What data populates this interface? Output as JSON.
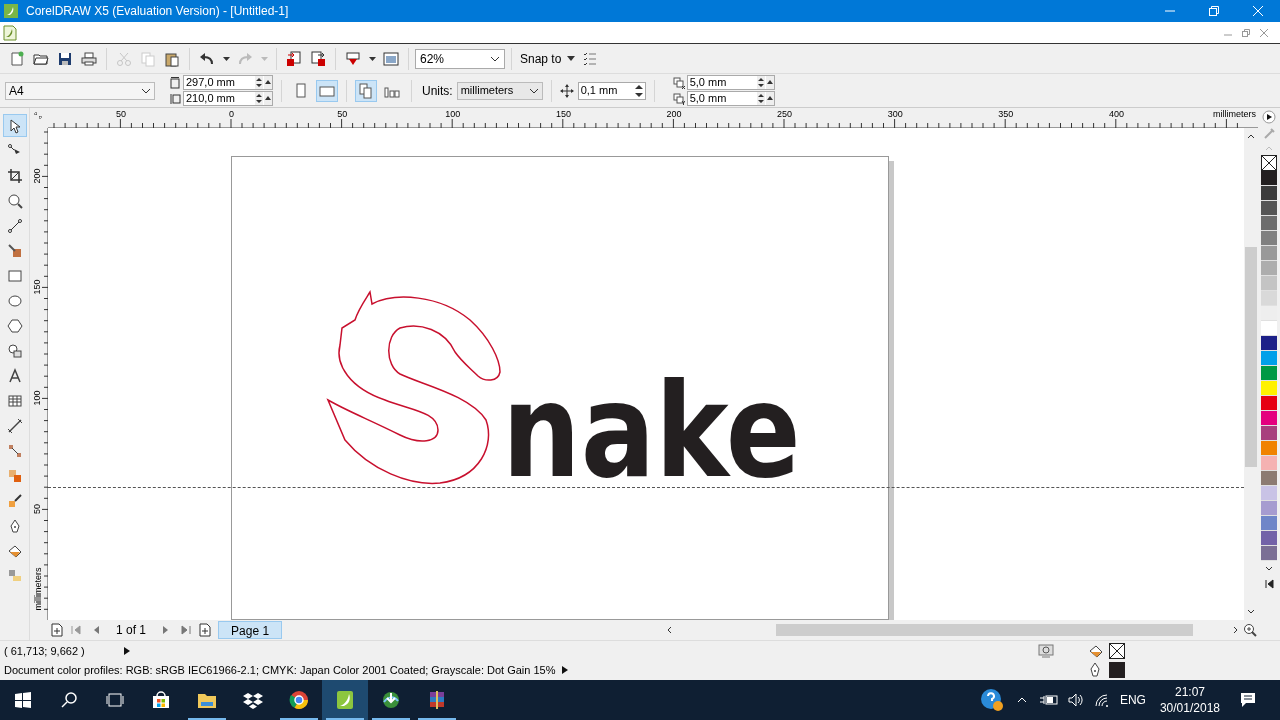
{
  "window": {
    "title": "CorelDRAW X5 (Evaluation Version) - [Untitled-1]"
  },
  "standard_toolbar": {
    "zoom_level": "62%",
    "snap_to": "Snap to"
  },
  "property_bar": {
    "page_size": "A4",
    "width": "297,0 mm",
    "height": "210,0 mm",
    "orientation": [
      {
        "kind": "portrait",
        "selected": false
      },
      {
        "kind": "landscape",
        "selected": true
      }
    ],
    "page_layout": [
      {
        "kind": "all-pages",
        "selected": true
      },
      {
        "kind": "current-page",
        "selected": false
      }
    ],
    "units_label": "Units:",
    "units": "millimeters",
    "nudge": "0,1 mm",
    "duplicate_x": "5,0 mm",
    "duplicate_y": "5,0 mm"
  },
  "toolbox": [
    {
      "kind": "pick",
      "selected": true
    },
    {
      "kind": "shape",
      "selected": false
    },
    {
      "kind": "crop",
      "selected": false
    },
    {
      "kind": "zoom",
      "selected": false
    },
    {
      "kind": "curve",
      "selected": false
    },
    {
      "kind": "smart-fill",
      "selected": false
    },
    {
      "kind": "rectangle",
      "selected": false
    },
    {
      "kind": "ellipse",
      "selected": false
    },
    {
      "kind": "polygon",
      "selected": false
    },
    {
      "kind": "basic-shapes",
      "selected": false
    },
    {
      "kind": "text",
      "selected": false
    },
    {
      "kind": "table",
      "selected": false
    },
    {
      "kind": "dimension",
      "selected": false
    },
    {
      "kind": "connector",
      "selected": false
    },
    {
      "kind": "effects",
      "selected": false
    },
    {
      "kind": "eyedropper",
      "selected": false
    },
    {
      "kind": "outline",
      "selected": false
    },
    {
      "kind": "fill",
      "selected": false
    },
    {
      "kind": "interactive-fill",
      "selected": false
    }
  ],
  "rulers": {
    "horizontal": {
      "labels": [
        "50",
        "0",
        "50",
        "100",
        "150",
        "200",
        "250",
        "300",
        "350",
        "400"
      ],
      "unit": "millimeters"
    },
    "vertical": {
      "labels": [
        "200",
        "150",
        "100",
        "50"
      ],
      "unit": "millimeters"
    }
  },
  "canvas": {
    "text": "nake"
  },
  "page_navigator": {
    "count": "1 of 1",
    "tabs": [
      {
        "label": "Page 1",
        "selected": true
      }
    ]
  },
  "status_bar": {
    "cursor_position": "( 61,713; 9,662 )",
    "color_profiles": "Document color profiles: RGB: sRGB IEC61966-2.1; CMYK: Japan Color 2001 Coated; Grayscale: Dot Gain 15%"
  },
  "palette": [
    {
      "color": "#231f20"
    },
    {
      "color": "#3c3c3c"
    },
    {
      "color": "#555555"
    },
    {
      "color": "#6d6d6d"
    },
    {
      "color": "#808080"
    },
    {
      "color": "#999999"
    },
    {
      "color": "#adadad"
    },
    {
      "color": "#c4c4c4"
    },
    {
      "color": "#d9d9d9"
    },
    {
      "color": "#eeeeee"
    },
    {
      "color": "#ffffff"
    },
    {
      "color": "#1d2088"
    },
    {
      "color": "#00a0e9"
    },
    {
      "color": "#009944"
    },
    {
      "color": "#fff100"
    },
    {
      "color": "#e60012"
    },
    {
      "color": "#e4007f"
    },
    {
      "color": "#a8407e"
    },
    {
      "color": "#f08300"
    },
    {
      "color": "#f5b2b2"
    },
    {
      "color": "#8c7b72"
    },
    {
      "color": "#c9c3e6"
    },
    {
      "color": "#a69cd0"
    },
    {
      "color": "#6f86c8"
    },
    {
      "color": "#7362a8"
    },
    {
      "color": "#7b6f95"
    }
  ],
  "taskbar": {
    "apps": [
      {
        "kind": "store",
        "selected": false,
        "running": false
      },
      {
        "kind": "explorer",
        "selected": false,
        "running": true
      },
      {
        "kind": "dropbox",
        "selected": false,
        "running": false
      },
      {
        "kind": "chrome",
        "selected": false,
        "running": true
      },
      {
        "kind": "coreldraw",
        "selected": true,
        "running": true
      },
      {
        "kind": "download-manager",
        "selected": false,
        "running": true
      },
      {
        "kind": "archiver",
        "selected": false,
        "running": true
      }
    ],
    "tray": {
      "language": "ENG",
      "time": "21:07",
      "date": "30/01/2018"
    }
  }
}
